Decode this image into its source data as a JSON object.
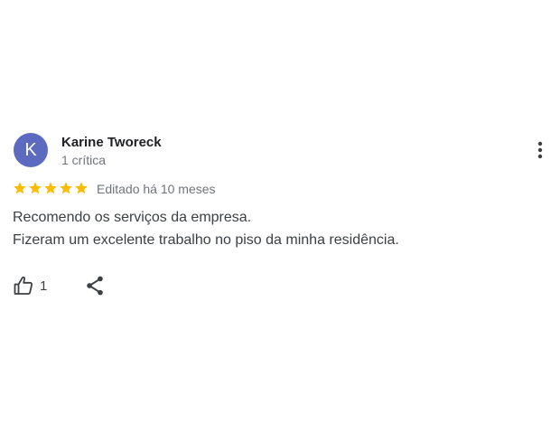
{
  "review": {
    "avatar_letter": "K",
    "avatar_color": "#5c6bc0",
    "author_name": "Karine Tworeck",
    "author_meta": "1 crítica",
    "rating": 5,
    "rating_max": 5,
    "star_color": "#fbbc04",
    "edited_text": "Editado há 10 meses",
    "text_lines": [
      "Recomendo os serviços da empresa.",
      "Fizeram um excelente trabalho no piso da minha residência."
    ],
    "like_count": "1",
    "icons": {
      "more": "more-vert-icon",
      "like": "thumbs-up-icon",
      "share": "share-icon"
    }
  }
}
